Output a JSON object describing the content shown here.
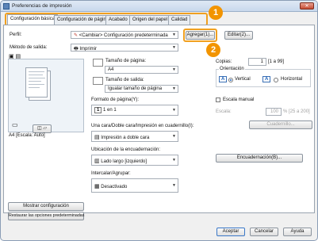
{
  "window": {
    "title": "Preferencias de impresión",
    "close_glyph": "✕"
  },
  "tabs": [
    {
      "label": "Configuración básica"
    },
    {
      "label": "Configuración de página"
    },
    {
      "label": "Acabado"
    },
    {
      "label": "Origen del papel"
    },
    {
      "label": "Calidad"
    }
  ],
  "profile": {
    "label": "Perfil:",
    "value": "<Cambiar> Configuración predeterminada",
    "add_button": "Agregar(1)...",
    "edit_button": "Editar(2)..."
  },
  "output_method": {
    "label": "Método de salida:",
    "value": "Imprimir"
  },
  "preview": {
    "caption": "A4 [Escala: Auto]"
  },
  "page_size": {
    "label": "Tamaño de página:",
    "value": "A4"
  },
  "output_size": {
    "label": "Tamaño de salida:",
    "value": "Igualar tamaño de página"
  },
  "copies": {
    "label": "Copias:",
    "value": "1",
    "range": "[1 a 99]"
  },
  "orientation": {
    "label": "Orientación",
    "portrait": "Vertical",
    "landscape": "Horizontal",
    "selected": "portrait"
  },
  "page_layout": {
    "label": "Formato de página(Y):",
    "value": "1 en 1"
  },
  "manual_scaling": {
    "label": "Escala manual",
    "checked": false,
    "scale_label": "Escala:",
    "scale_value": "100",
    "scale_range": "% [25 a 200]"
  },
  "duplex": {
    "label": "Una cara/Doble cara/Impresión en cuadernillo(I):",
    "value": "Impresión a doble cara",
    "booklet_button": "Cuadernillo..."
  },
  "binding": {
    "label": "Ubicación de la encuadernación:",
    "value": "Lado largo [izquierdo]",
    "binding_button": "Encuadernación(B)..."
  },
  "collate": {
    "label": "Intercalar/Agrupar:",
    "value": "Desactivado"
  },
  "left_buttons": {
    "show_config": "Mostrar configuración",
    "restore_defaults": "Restaurar las opciones predeterminadas"
  },
  "footer": {
    "ok": "Aceptar",
    "cancel": "Cancelar",
    "help": "Ayuda"
  },
  "callouts": [
    "1",
    "2"
  ],
  "colors": {
    "highlight": "#f0a020",
    "callout": "#f29400"
  }
}
